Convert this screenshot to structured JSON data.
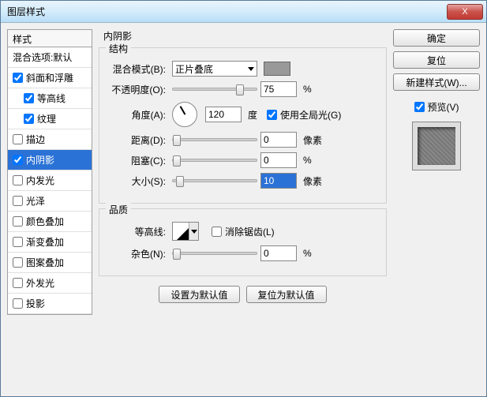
{
  "titlebar": {
    "title": "图层样式",
    "close": "X"
  },
  "sidebar": {
    "header": "样式",
    "items": [
      {
        "label": "混合选项:默认",
        "checked": null
      },
      {
        "label": "斜面和浮雕",
        "checked": true
      },
      {
        "label": "等高线",
        "checked": true,
        "indent": true
      },
      {
        "label": "纹理",
        "checked": true,
        "indent": true
      },
      {
        "label": "描边",
        "checked": false
      },
      {
        "label": "内阴影",
        "checked": true,
        "selected": true
      },
      {
        "label": "内发光",
        "checked": false
      },
      {
        "label": "光泽",
        "checked": false
      },
      {
        "label": "颜色叠加",
        "checked": false
      },
      {
        "label": "渐变叠加",
        "checked": false
      },
      {
        "label": "图案叠加",
        "checked": false
      },
      {
        "label": "外发光",
        "checked": false
      },
      {
        "label": "投影",
        "checked": false
      }
    ]
  },
  "panel": {
    "title": "内阴影",
    "structure": {
      "legend": "结构",
      "blend_mode_label": "混合模式(B):",
      "blend_mode_value": "正片叠底",
      "opacity_label": "不透明度(O):",
      "opacity_value": "75",
      "opacity_unit": "%",
      "angle_label": "角度(A):",
      "angle_value": "120",
      "angle_unit": "度",
      "global_light_label": "使用全局光(G)",
      "global_light_checked": true,
      "distance_label": "距离(D):",
      "distance_value": "0",
      "distance_unit": "像素",
      "choke_label": "阻塞(C):",
      "choke_value": "0",
      "choke_unit": "%",
      "size_label": "大小(S):",
      "size_value": "10",
      "size_unit": "像素"
    },
    "quality": {
      "legend": "品质",
      "contour_label": "等高线:",
      "antialias_label": "消除锯齿(L)",
      "antialias_checked": false,
      "noise_label": "杂色(N):",
      "noise_value": "0",
      "noise_unit": "%"
    },
    "buttons": {
      "make_default": "设置为默认值",
      "reset_default": "复位为默认值"
    }
  },
  "right": {
    "ok": "确定",
    "cancel": "复位",
    "new_style": "新建样式(W)...",
    "preview_label": "预览(V)",
    "preview_checked": true
  }
}
